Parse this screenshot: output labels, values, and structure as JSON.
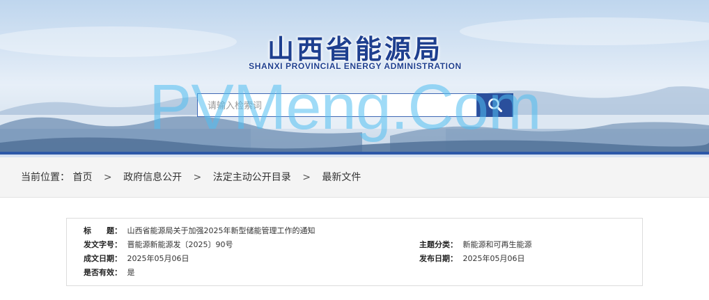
{
  "header": {
    "logo_cn": "山西省能源局",
    "logo_en": "SHANXI PROVINCIAL ENERGY ADMINISTRATION",
    "watermark": "PVMeng.Com"
  },
  "search": {
    "placeholder": "请输入检索词",
    "button_icon": "search-icon"
  },
  "breadcrumb": {
    "prefix": "当前位置：",
    "items": [
      "首页",
      "政府信息公开",
      "法定主动公开目录",
      "最新文件"
    ],
    "separator": ">"
  },
  "document_info": {
    "title_label": "标　　题：",
    "title_value": "山西省能源局关于加强2025年新型储能管理工作的通知",
    "doc_number_label": "发文字号：",
    "doc_number_value": "晋能源新能源发〔2025〕90号",
    "category_label": "主题分类：",
    "category_value": "新能源和可再生能源",
    "created_date_label": "成文日期：",
    "created_date_value": "2025年05月06日",
    "publish_date_label": "发布日期：",
    "publish_date_value": "2025年05月06日",
    "valid_label": "是否有效：",
    "valid_value": "是"
  },
  "colors": {
    "brand_blue": "#2a4f9c",
    "logo_blue": "#1e3f8f",
    "watermark": "#50bef0"
  }
}
